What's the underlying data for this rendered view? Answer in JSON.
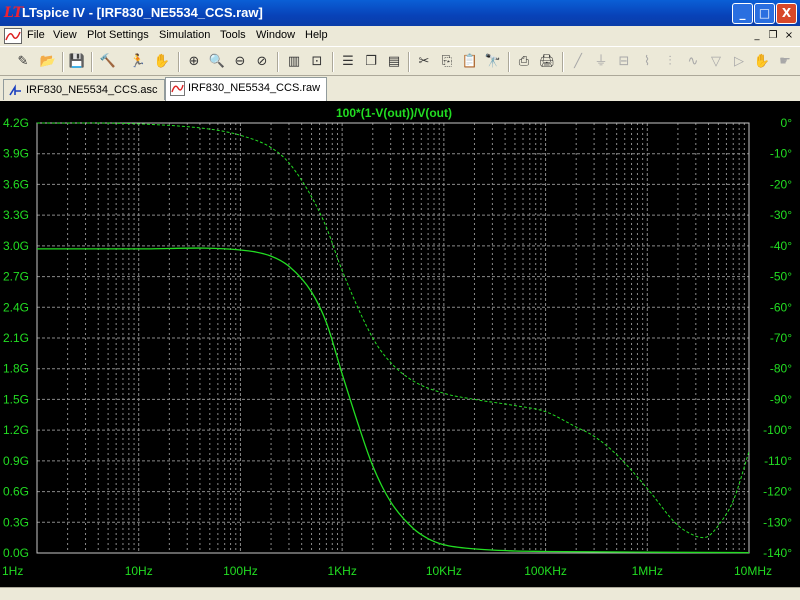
{
  "window": {
    "app_icon": "ltspice-logo-icon",
    "title": "LTspice IV - [IRF830_NE5534_CCS.raw]",
    "buttons": {
      "minimize": "_",
      "maximize": "□",
      "close": "X"
    }
  },
  "menu": {
    "items": [
      "File",
      "View",
      "Plot Settings",
      "Simulation",
      "Tools",
      "Window",
      "Help"
    ],
    "mdi_buttons": {
      "minimize": "_",
      "restore": "❐",
      "close": "×"
    }
  },
  "toolbar": {
    "buttons": [
      {
        "name": "new-schematic-icon",
        "glyph": "✎"
      },
      {
        "name": "open-icon",
        "glyph": "📂"
      },
      {
        "name": "save-icon",
        "glyph": "💾"
      },
      {
        "name": "control-panel-icon",
        "glyph": "🔨"
      },
      {
        "name": "run-icon",
        "glyph": "🏃"
      },
      {
        "name": "halt-icon",
        "glyph": "✋"
      },
      {
        "name": "zoom-in-icon",
        "glyph": "⊕"
      },
      {
        "name": "zoom-out-icon",
        "glyph": "🔍"
      },
      {
        "name": "zoom-fit-icon",
        "glyph": "⊖"
      },
      {
        "name": "zoom-cancel-icon",
        "glyph": "⊘"
      },
      {
        "name": "autorange-icon",
        "glyph": "▥"
      },
      {
        "name": "mark-icon",
        "glyph": "⊡"
      },
      {
        "name": "tile-horizontal-icon",
        "glyph": "☰"
      },
      {
        "name": "cascade-icon",
        "glyph": "❐"
      },
      {
        "name": "tile-vertical-icon",
        "glyph": "▤"
      },
      {
        "name": "cut-icon",
        "glyph": "✂"
      },
      {
        "name": "copy-icon",
        "glyph": "⎘"
      },
      {
        "name": "paste-icon",
        "glyph": "📋"
      },
      {
        "name": "find-icon",
        "glyph": "🔭"
      },
      {
        "name": "print-preview-icon",
        "glyph": "⎙"
      },
      {
        "name": "print-icon",
        "glyph": "🖨"
      },
      {
        "name": "wire-icon",
        "glyph": "╱"
      },
      {
        "name": "ground-icon",
        "glyph": "⏚"
      },
      {
        "name": "label-icon",
        "glyph": "⊟"
      },
      {
        "name": "resistor-icon",
        "glyph": "⌇"
      },
      {
        "name": "capacitor-icon",
        "glyph": "⫶"
      },
      {
        "name": "inductor-icon",
        "glyph": "∿"
      },
      {
        "name": "diode-icon",
        "glyph": "▽"
      },
      {
        "name": "component-icon",
        "glyph": "▷"
      },
      {
        "name": "move-icon",
        "glyph": "✋"
      },
      {
        "name": "drag-icon",
        "glyph": "☛"
      }
    ]
  },
  "tabs": [
    {
      "label": "IRF830_NE5534_CCS.asc",
      "icon": "schematic-icon",
      "active": false
    },
    {
      "label": "IRF830_NE5534_CCS.raw",
      "icon": "waveform-icon",
      "active": true
    }
  ],
  "colors": {
    "trace": "#22dd22",
    "grid": "#8a8a8a",
    "axis_text": "#22dd22",
    "plot_bg": "#000000"
  },
  "chart_data": {
    "type": "line",
    "title": "100*(1-V(out))/V(out)",
    "x_scale": "log",
    "xlim": [
      1,
      10000000
    ],
    "x_ticks": [
      "1Hz",
      "10Hz",
      "100Hz",
      "1KHz",
      "10KHz",
      "100KHz",
      "1MHz",
      "10MHz"
    ],
    "y_left": {
      "ylim_G": [
        0,
        4.2
      ],
      "ticks": [
        "4.2G",
        "3.9G",
        "3.6G",
        "3.3G",
        "3.0G",
        "2.7G",
        "2.4G",
        "2.1G",
        "1.8G",
        "1.5G",
        "1.2G",
        "0.9G",
        "0.6G",
        "0.3G",
        "0.0G"
      ]
    },
    "y_right": {
      "ylim_deg": [
        -140,
        0
      ],
      "ticks": [
        "0°",
        "-10°",
        "-20°",
        "-30°",
        "-40°",
        "-50°",
        "-60°",
        "-70°",
        "-80°",
        "-90°",
        "-100°",
        "-110°",
        "-120°",
        "-130°",
        "-140°"
      ]
    },
    "grid": true,
    "series": [
      {
        "kind": "magnitude",
        "style": "solid",
        "x": [
          1,
          10,
          100,
          200,
          300,
          500,
          700,
          1000,
          1500,
          2000,
          3000,
          5000,
          7000,
          10000,
          20000,
          50000,
          100000,
          1000000,
          10000000
        ],
        "y_G": [
          2.97,
          2.97,
          2.96,
          2.9,
          2.8,
          2.55,
          2.25,
          1.75,
          1.2,
          0.85,
          0.5,
          0.24,
          0.14,
          0.08,
          0.04,
          0.02,
          0.015,
          0.008,
          0.004
        ]
      },
      {
        "kind": "phase",
        "style": "dashed",
        "x": [
          1,
          10,
          50,
          100,
          200,
          300,
          500,
          700,
          1000,
          2000,
          3000,
          5000,
          10000,
          20000,
          50000,
          100000,
          200000,
          300000,
          500000,
          1000000,
          2000000,
          3000000,
          3500000,
          4000000,
          5000000,
          7000000,
          10000000
        ],
        "y_deg": [
          0,
          -0.3,
          -2,
          -4,
          -8,
          -13,
          -24,
          -34,
          -48,
          -70,
          -78,
          -84,
          -88,
          -90,
          -92,
          -94,
          -99,
          -102,
          -108,
          -119,
          -131,
          -134.5,
          -135,
          -134.5,
          -131,
          -123,
          -107
        ]
      }
    ]
  }
}
